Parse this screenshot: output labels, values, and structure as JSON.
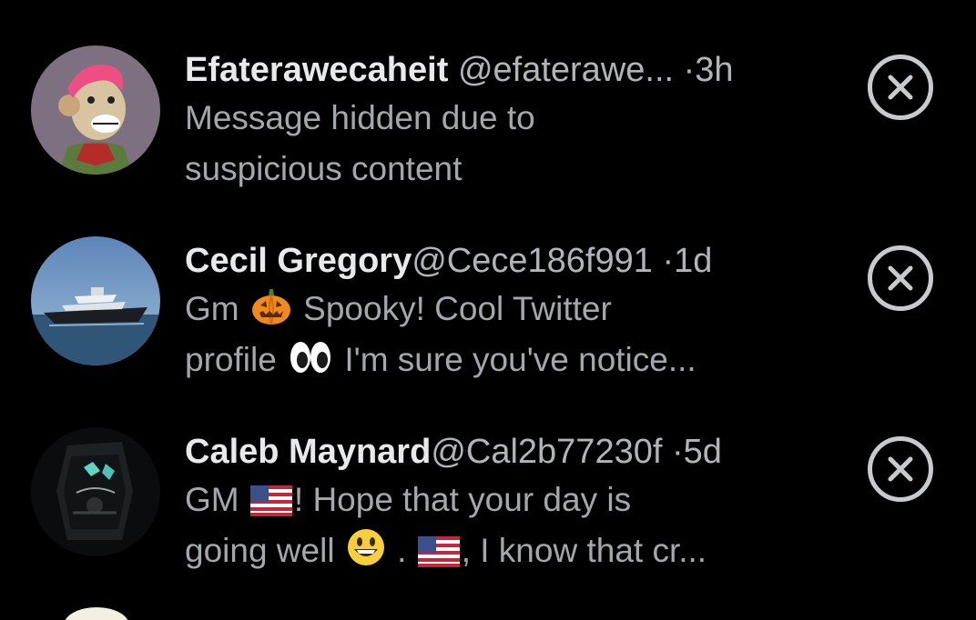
{
  "messages": [
    {
      "name": "Efaterawecaheit",
      "handle": "@efaterawe...",
      "separator": "·",
      "time": "3h",
      "text_lines": [
        "Message hidden due to",
        "suspicious content"
      ],
      "avatar_icon": "pink-haired-ape-avatar",
      "dismiss_icon": "close-circle-icon"
    },
    {
      "name": "Cecil Gregory",
      "handle": "@Cece186f991",
      "separator": "·",
      "time": "1d",
      "line1_a": "Gm",
      "line1_emoji": "jack-o-lantern",
      "line1_b": "Spooky! Cool Twitter",
      "line2_a": "profile",
      "line2_emoji": "eyes",
      "line2_b": "I'm sure you've notice...",
      "avatar_icon": "yacht-avatar",
      "dismiss_icon": "close-circle-icon"
    },
    {
      "name": "Caleb Maynard",
      "handle": "@Cal2b77230f",
      "separator": "·",
      "time": "5d",
      "line1_a": "GM",
      "line1_emoji": "us-flag",
      "line1_b": "! Hope that your day is",
      "line2_a": "going well",
      "line2_emoji": "grinning-face",
      "line2_mid": ".",
      "line2_emoji2": "us-flag",
      "line2_b": ", I know that cr...",
      "avatar_icon": "wristwatch-avatar",
      "dismiss_icon": "close-circle-icon"
    }
  ],
  "colors": {
    "background": "#000000",
    "name": "#e7e9ea",
    "secondary": "#b0b5b9",
    "message": "#a3a8ad",
    "dismiss": "#c7cbce"
  }
}
